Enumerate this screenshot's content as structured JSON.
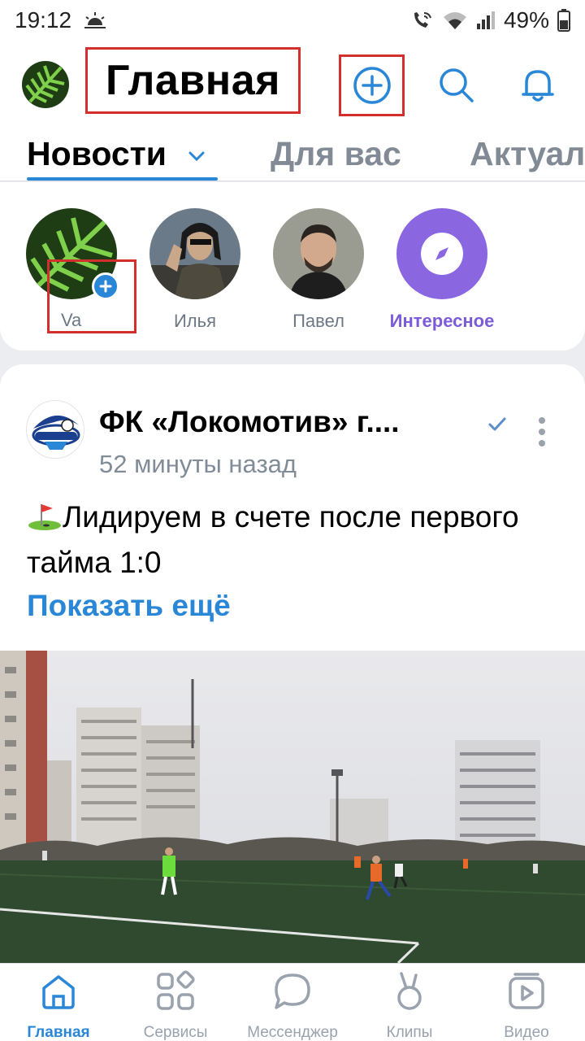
{
  "status_bar": {
    "time": "19:12",
    "battery": "49%"
  },
  "header": {
    "title": "Главная"
  },
  "tabs": [
    {
      "label": "Новости",
      "active": true
    },
    {
      "label": "Для вас",
      "active": false
    },
    {
      "label": "Актуал",
      "active": false
    }
  ],
  "stories": [
    {
      "name": "Va"
    },
    {
      "name": "Илья"
    },
    {
      "name": "Павел"
    },
    {
      "name": "Интересное"
    }
  ],
  "post": {
    "author": "ФК «Локомотив» г....",
    "time": "52 минуты назад",
    "text": "Лидируем в счете после первого тайма 1:0",
    "show_more": "Показать ещё"
  },
  "bottom_nav": [
    {
      "label": "Главная",
      "icon": "home-icon",
      "active": true
    },
    {
      "label": "Сервисы",
      "icon": "services-icon",
      "active": false
    },
    {
      "label": "Мессенджер",
      "icon": "messenger-icon",
      "active": false
    },
    {
      "label": "Клипы",
      "icon": "clips-icon",
      "active": false
    },
    {
      "label": "Видео",
      "icon": "video-icon",
      "active": false
    }
  ],
  "colors": {
    "accent": "#2a87d8",
    "highlight_box": "#d32f2f",
    "interesting": "#7c5bd9"
  }
}
